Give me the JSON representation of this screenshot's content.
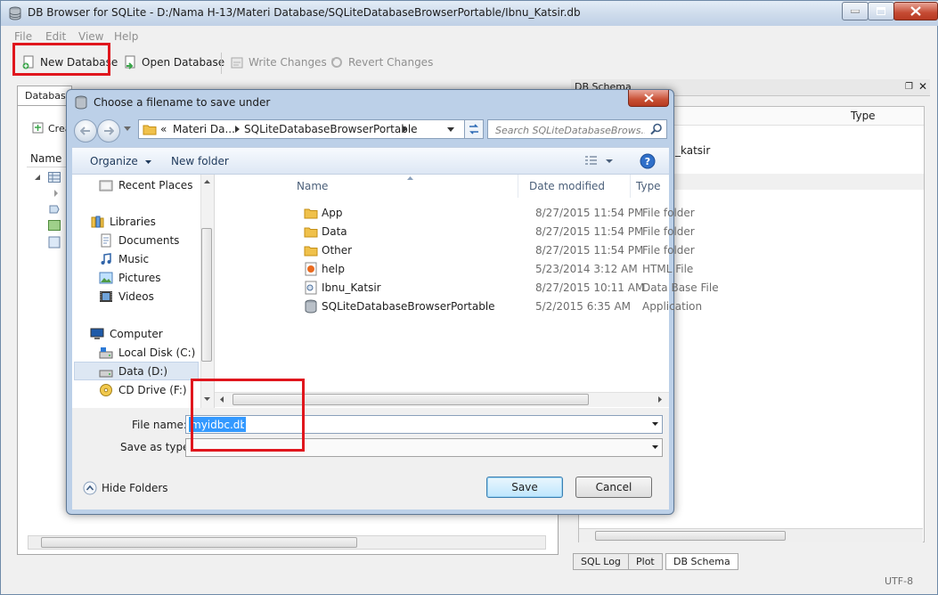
{
  "main_window": {
    "title": "DB Browser for SQLite - D:/Nama H-13/Materi Database/SQLiteDatabaseBrowserPortable/Ibnu_Katsir.db",
    "menu": [
      "File",
      "Edit",
      "View",
      "Help"
    ],
    "toolbar": {
      "new_database": "New Database",
      "open_database": "Open Database",
      "write_changes": "Write Changes",
      "revert_changes": "Revert Changes"
    },
    "left": {
      "tab_database": "Database",
      "create_button_partial": "Crea",
      "col_name": "Name"
    },
    "schema": {
      "title": "DB Schema",
      "col_type": "Type",
      "partial_entry": "_katsir"
    },
    "bottom_tabs": [
      "SQL Log",
      "Plot",
      "DB Schema"
    ],
    "status_encoding": "UTF-8"
  },
  "dialog": {
    "title": "Choose a filename to save under",
    "breadcrumb": {
      "overflow": "«",
      "items": [
        "Materi Da...",
        "SQLiteDatabaseBrowserPortable"
      ]
    },
    "search_placeholder": "Search SQLiteDatabaseBrows...",
    "organize_label": "Organize",
    "new_folder_label": "New folder",
    "nav": {
      "recent_places": "Recent Places",
      "libraries": "Libraries",
      "documents": "Documents",
      "music": "Music",
      "pictures": "Pictures",
      "videos": "Videos",
      "computer": "Computer",
      "local_disk": "Local Disk (C:)",
      "data_drive": "Data (D:)",
      "cd_drive": "CD Drive (F:)"
    },
    "columns": {
      "name": "Name",
      "date_modified": "Date modified",
      "type": "Type"
    },
    "files": [
      {
        "name": "App",
        "date": "8/27/2015 11:54 PM",
        "type": "File folder",
        "icon": "folder-icon"
      },
      {
        "name": "Data",
        "date": "8/27/2015 11:54 PM",
        "type": "File folder",
        "icon": "folder-icon"
      },
      {
        "name": "Other",
        "date": "8/27/2015 11:54 PM",
        "type": "File folder",
        "icon": "folder-icon"
      },
      {
        "name": "help",
        "date": "5/23/2014 3:12 AM",
        "type": "HTML File",
        "icon": "html-file-icon"
      },
      {
        "name": "Ibnu_Katsir",
        "date": "8/27/2015 10:11 AM",
        "type": "Data Base File",
        "icon": "database-file-icon"
      },
      {
        "name": "SQLiteDatabaseBrowserPortable",
        "date": "5/2/2015 6:35 AM",
        "type": "Application",
        "icon": "application-icon"
      }
    ],
    "file_name_label": "File name:",
    "file_name_value": "myidbc.db",
    "save_as_type_label": "Save as type:",
    "hide_folders_label": "Hide Folders",
    "save_label": "Save",
    "cancel_label": "Cancel"
  },
  "colors": {
    "highlight": "#e0161d",
    "selection": "#3399ff",
    "dialog_frame": "#bcd0e8"
  }
}
